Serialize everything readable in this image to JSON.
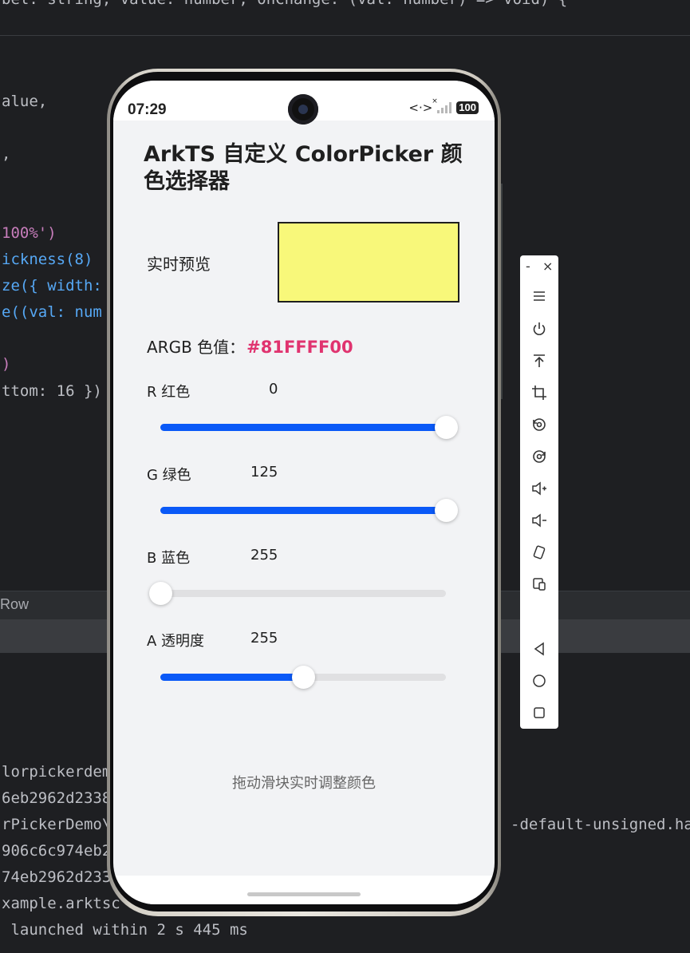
{
  "ide": {
    "code_lines": [
      "alue,",
      ",",
      "100%')",
      "ickness(8)",
      "ze({ width:",
      "e((val: num",
      ")",
      "ttom: 16 })"
    ],
    "top_line": "bel: string, value: number, onChange: (val: number) => void) {",
    "bar_label": "Row",
    "console_lines": [
      "lorpickerdem",
      "6eb2962d2338",
      "rPickerDemo\\",
      "906c6c974eb2",
      "74eb2962d233",
      "xample.arktsc",
      " launched within 2 s 445 ms"
    ],
    "console_right": "-default-unsigned.ha"
  },
  "status_bar": {
    "time": "07:29",
    "battery": "100"
  },
  "app": {
    "title": "ArkTS 自定义 ColorPicker 颜色选择器",
    "preview_label": "实时预览",
    "preview_color": "#F8F87A",
    "argb_label": "ARGB 色值：",
    "argb_value": "#81FFFF00",
    "channels": [
      {
        "label": "R 红色",
        "value": "0",
        "fill_fraction": 1.0
      },
      {
        "label": "G 绿色",
        "value": "125",
        "fill_fraction": 1.0
      },
      {
        "label": "B 蓝色",
        "value": "255",
        "fill_fraction": 0.0
      },
      {
        "label": "A 透明度",
        "value": "255",
        "fill_fraction": 0.5
      }
    ],
    "hint": "拖动滑块实时调整颜色"
  },
  "colors": {
    "accent": "#0A59F7",
    "argb_text": "#E0336F"
  },
  "toolbar": {
    "minimize": "-",
    "close": "×",
    "icons": [
      "menu-icon",
      "power-icon",
      "pin-top-icon",
      "crop-screenshot-icon",
      "rotate-left-icon",
      "rotate-right-icon",
      "volume-up-icon",
      "volume-down-icon",
      "shake-icon",
      "multi-device-icon",
      "back-icon",
      "home-icon",
      "recents-icon"
    ]
  }
}
